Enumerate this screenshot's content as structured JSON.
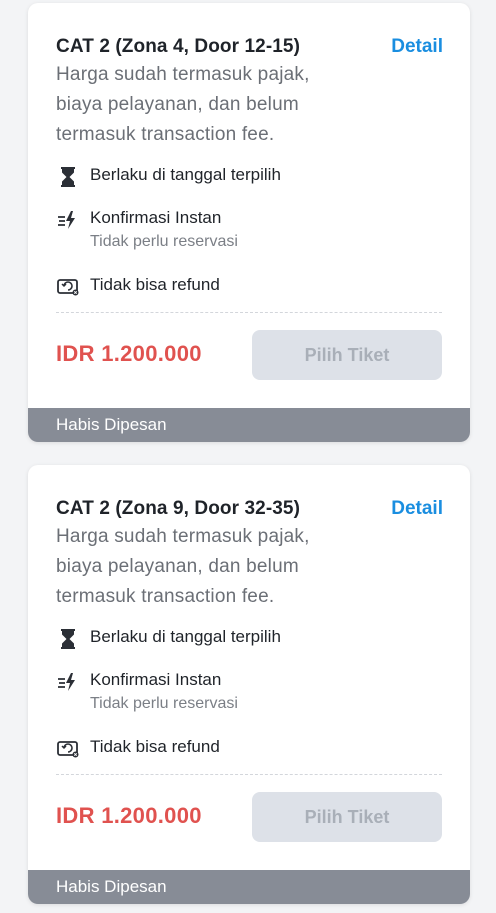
{
  "tickets": [
    {
      "title": "CAT 2 (Zona 4, Door 12-15)",
      "detail_label": "Detail",
      "desc_lines": [
        "Harga sudah termasuk pajak,",
        "biaya pelayanan, dan belum",
        "termasuk transaction fee."
      ],
      "features": [
        {
          "icon": "hourglass-icon",
          "label": "Berlaku di tanggal terpilih"
        },
        {
          "icon": "instant-lightning-icon",
          "label": "Konfirmasi Instan",
          "sub": "Tidak perlu reservasi"
        },
        {
          "icon": "no-refund-icon",
          "label": "Tidak bisa refund"
        }
      ],
      "price": "IDR 1.200.000",
      "button_label": "Pilih Tiket",
      "status": "Habis Dipesan"
    },
    {
      "title": "CAT 2 (Zona 9, Door 32-35)",
      "detail_label": "Detail",
      "desc_lines": [
        "Harga sudah termasuk pajak,",
        "biaya pelayanan, dan belum",
        "termasuk transaction fee."
      ],
      "features": [
        {
          "icon": "hourglass-icon",
          "label": "Berlaku di tanggal terpilih"
        },
        {
          "icon": "instant-lightning-icon",
          "label": "Konfirmasi Instan",
          "sub": "Tidak perlu reservasi"
        },
        {
          "icon": "no-refund-icon",
          "label": "Tidak bisa refund"
        }
      ],
      "price": "IDR 1.200.000",
      "button_label": "Pilih Tiket",
      "status": "Habis Dipesan"
    }
  ],
  "colors": {
    "accent": "#1a8ee0",
    "price": "#e0524f",
    "footer": "#878c96",
    "disabled_button": "#dde1e8"
  }
}
